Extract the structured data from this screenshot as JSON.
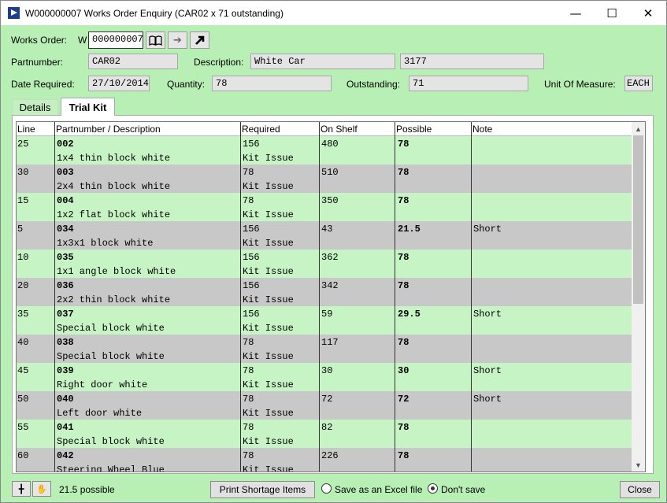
{
  "window": {
    "title": "W000000007 Works Order Enquiry (CAR02 x 71 outstanding)"
  },
  "header": {
    "works_order_label": "Works Order:",
    "works_order_prefix": "W",
    "works_order_value": "000000007",
    "partnumber_label": "Partnumber:",
    "partnumber_value": "CAR02",
    "description_label": "Description:",
    "description_value": "White Car",
    "description_extra": "3177",
    "date_required_label": "Date Required:",
    "date_required_value": "27/10/2014",
    "quantity_label": "Quantity:",
    "quantity_value": "78",
    "outstanding_label": "Outstanding:",
    "outstanding_value": "71",
    "uom_label": "Unit Of Measure:",
    "uom_value": "EACH"
  },
  "tabs": [
    {
      "label": "Details"
    },
    {
      "label": "Trial Kit"
    }
  ],
  "grid": {
    "columns": [
      "Line",
      "Partnumber / Description",
      "Required",
      "On Shelf",
      "Possible",
      "Note"
    ],
    "rows": [
      {
        "line": "25",
        "part": "002",
        "desc": "1x4 thin block white",
        "required": "156",
        "issue": "Kit Issue",
        "on_shelf": "480",
        "possible": "78",
        "note": ""
      },
      {
        "line": "30",
        "part": "003",
        "desc": "2x4 thin block white",
        "required": "78",
        "issue": "Kit Issue",
        "on_shelf": "510",
        "possible": "78",
        "note": ""
      },
      {
        "line": "15",
        "part": "004",
        "desc": "1x2 flat block white",
        "required": "78",
        "issue": "Kit Issue",
        "on_shelf": "350",
        "possible": "78",
        "note": ""
      },
      {
        "line": "5",
        "part": "034",
        "desc": "1x3x1 block white",
        "required": "156",
        "issue": "Kit Issue",
        "on_shelf": "43",
        "possible": "21.5",
        "note": "Short"
      },
      {
        "line": "10",
        "part": "035",
        "desc": "1x1 angle block white",
        "required": "156",
        "issue": "Kit Issue",
        "on_shelf": "362",
        "possible": "78",
        "note": ""
      },
      {
        "line": "20",
        "part": "036",
        "desc": "2x2 thin block white",
        "required": "156",
        "issue": "Kit Issue",
        "on_shelf": "342",
        "possible": "78",
        "note": ""
      },
      {
        "line": "35",
        "part": "037",
        "desc": "Special block white",
        "required": "156",
        "issue": "Kit Issue",
        "on_shelf": "59",
        "possible": "29.5",
        "note": "Short"
      },
      {
        "line": "40",
        "part": "038",
        "desc": "Special block white",
        "required": "78",
        "issue": "Kit Issue",
        "on_shelf": "117",
        "possible": "78",
        "note": ""
      },
      {
        "line": "45",
        "part": "039",
        "desc": "Right door white",
        "required": "78",
        "issue": "Kit Issue",
        "on_shelf": "30",
        "possible": "30",
        "note": "Short"
      },
      {
        "line": "50",
        "part": "040",
        "desc": "Left door white",
        "required": "78",
        "issue": "Kit Issue",
        "on_shelf": "72",
        "possible": "72",
        "note": "Short"
      },
      {
        "line": "55",
        "part": "041",
        "desc": "Special block white",
        "required": "78",
        "issue": "Kit Issue",
        "on_shelf": "82",
        "possible": "78",
        "note": ""
      },
      {
        "line": "60",
        "part": "042",
        "desc": "Steering Wheel Blue",
        "required": "78",
        "issue": "Kit Issue",
        "on_shelf": "226",
        "possible": "78",
        "note": ""
      }
    ]
  },
  "footer": {
    "possible_text": "21.5 possible",
    "print_button": "Print Shortage Items",
    "excel_option": "Save as an Excel file",
    "dont_save_option": "Don't save",
    "close_button": "Close"
  },
  "colors": {
    "background": "#b7efb5",
    "row_light": "#c7f4c4",
    "row_dark": "#c8c8c8"
  }
}
